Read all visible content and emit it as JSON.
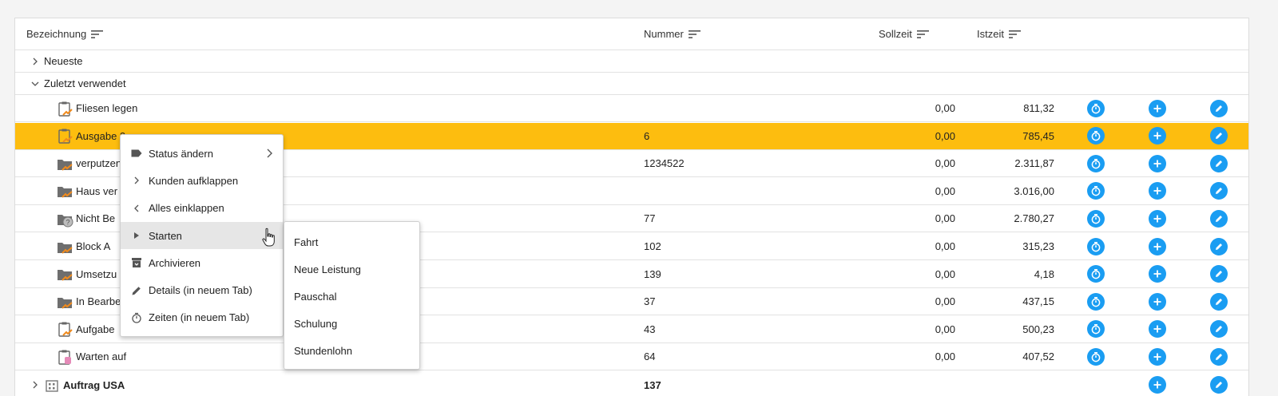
{
  "columns": {
    "bezeichnung": "Bezeichnung",
    "nummer": "Nummer",
    "sollzeit": "Sollzeit",
    "istzeit": "Istzeit"
  },
  "groups": [
    {
      "label": "Neueste",
      "expanded": false
    },
    {
      "label": "Zuletzt verwendet",
      "expanded": true
    }
  ],
  "rows": [
    {
      "name": "Fliesen legen",
      "nummer": "",
      "sollzeit": "0,00",
      "istzeit": "811,32",
      "icon": "clipboard-icon",
      "selected": false
    },
    {
      "name": "Ausgabe 2",
      "nummer": "6",
      "sollzeit": "0,00",
      "istzeit": "785,45",
      "icon": "clipboard-icon",
      "selected": true
    },
    {
      "name": "verputzen",
      "nummer": "1234522",
      "sollzeit": "0,00",
      "istzeit": "2.311,87",
      "icon": "folder-icon",
      "selected": false
    },
    {
      "name": "Haus ver",
      "nummer": "",
      "sollzeit": "0,00",
      "istzeit": "3.016,00",
      "icon": "folder-icon",
      "selected": false
    },
    {
      "name": "Nicht Be",
      "nummer": "77",
      "sollzeit": "0,00",
      "istzeit": "2.780,27",
      "icon": "folder-question-icon",
      "selected": false
    },
    {
      "name": "Block A",
      "nummer": "102",
      "sollzeit": "0,00",
      "istzeit": "315,23",
      "icon": "folder-icon",
      "selected": false
    },
    {
      "name": "Umsetzu",
      "nummer": "139",
      "sollzeit": "0,00",
      "istzeit": "4,18",
      "icon": "folder-icon",
      "selected": false
    },
    {
      "name": "In Bearbe",
      "nummer": "37",
      "sollzeit": "0,00",
      "istzeit": "437,15",
      "icon": "folder-icon",
      "selected": false
    },
    {
      "name": "Aufgabe",
      "nummer": "43",
      "sollzeit": "0,00",
      "istzeit": "500,23",
      "icon": "clipboard-icon",
      "selected": false
    },
    {
      "name": "Warten auf",
      "nummer": "64",
      "sollzeit": "0,00",
      "istzeit": "407,52",
      "icon": "clipboard-pink-icon",
      "selected": false
    }
  ],
  "bottom_row": {
    "name": "Auftrag USA",
    "nummer": "137",
    "icon": "building-icon"
  },
  "context_menu": [
    {
      "label": "Status ändern",
      "icon": "tag-icon",
      "submenu": true
    },
    {
      "label": "Kunden aufklappen",
      "icon": "chevron-right-icon",
      "submenu": false
    },
    {
      "label": "Alles einklappen",
      "icon": "chevron-left-icon",
      "submenu": false
    },
    {
      "label": "Starten",
      "icon": "play-icon",
      "submenu": false,
      "active": true
    },
    {
      "label": "Archivieren",
      "icon": "archive-icon",
      "submenu": false
    },
    {
      "label": "Details (in neuem Tab)",
      "icon": "pencil-icon",
      "submenu": false
    },
    {
      "label": "Zeiten (in neuem Tab)",
      "icon": "timer-icon",
      "submenu": false
    }
  ],
  "submenu": [
    "Fahrt",
    "Neue Leistung",
    "Pauschal",
    "Schulung",
    "Stundenlohn"
  ],
  "colors": {
    "selected_row": "#fdbd0f",
    "action_blue": "#1a9df2",
    "icon_orange": "#f08a1c"
  }
}
